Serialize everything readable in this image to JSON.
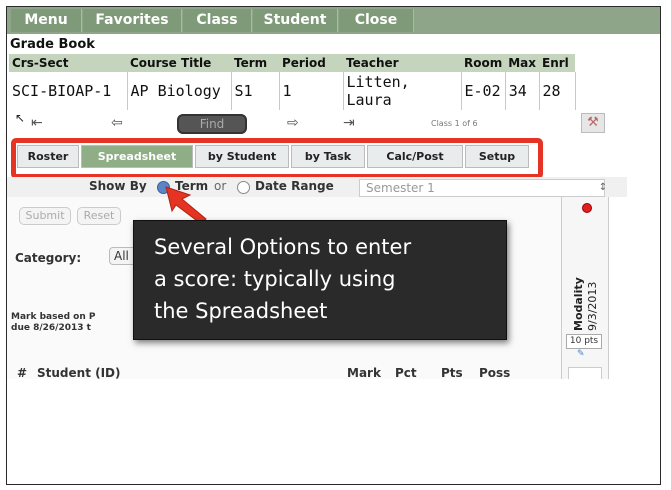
{
  "menu": {
    "items": [
      "Menu",
      "Favorites",
      "Class",
      "Student",
      "Close"
    ]
  },
  "grade_book": {
    "title": "Grade Book",
    "columns": [
      "Crs-Sect",
      "Course Title",
      "Term",
      "Period",
      "Teacher",
      "Room",
      "Max",
      "Enrl"
    ],
    "row": [
      "SCI-BIOAP-1",
      "AP Biology",
      "S1",
      "1",
      "Litten, Laura",
      "E-02",
      "34",
      "28"
    ]
  },
  "nav": {
    "find_label": "Find",
    "class_of": "Class 1 of 6"
  },
  "tabs": [
    "Roster",
    "Spreadsheet",
    "by Student",
    "by Task",
    "Calc/Post",
    "Setup"
  ],
  "active_tab": "Spreadsheet",
  "show_by": {
    "label": "Show By",
    "opt_term": "Term",
    "or": "or",
    "opt_date": "Date Range",
    "semester": "Semester 1"
  },
  "form": {
    "submit": "Submit",
    "reset": "Reset",
    "category_label": "Category:",
    "category_value": "All",
    "mark_based_line1": "Mark based on P",
    "mark_based_line2": "due 8/26/2013 t"
  },
  "callout": {
    "line1": "Several Options to enter",
    "line2": "a score: typically using",
    "line3": "the Spreadsheet"
  },
  "assignment": {
    "name": "Modality",
    "date": "9/3/2013",
    "points": "10 pts"
  },
  "student_table": {
    "headers": [
      "#",
      "Student (ID)",
      "Mark",
      "Pct",
      "Pts",
      "Poss"
    ]
  },
  "colors": {
    "menubar": "#8fa58a",
    "highlight": "#e53423",
    "callout_bg": "#2a2a2a"
  }
}
